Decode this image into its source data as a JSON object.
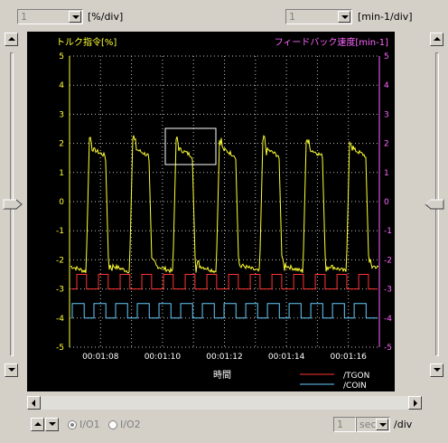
{
  "top": {
    "left_scale_value": "1",
    "left_scale_unit": "[%/div]",
    "right_scale_value": "1",
    "right_scale_unit": "[min-1/div]"
  },
  "chart_data": {
    "type": "line",
    "left_axis_label": "トルク指令[%]",
    "right_axis_label": "フィードバック速度[min-1]",
    "xlabel": "時間",
    "y_ticks": [
      "5",
      "4",
      "3",
      "2",
      "1",
      "0",
      "-1",
      "-2",
      "-3",
      "-4",
      "-5"
    ],
    "x_ticks": [
      "00:01:08",
      "00:01:10",
      "00:01:12",
      "00:01:14",
      "00:01:16"
    ],
    "ylim": [
      -5,
      5
    ],
    "grid": true,
    "colors": {
      "main": "#ffff33",
      "tgon": "#ff3333",
      "coin": "#66ccff",
      "right_axis": "#ff66ff",
      "grid": "#c0c0c0"
    },
    "series": [
      {
        "name": "/TGON",
        "color": "#ff3333",
        "low": -3.0,
        "high": -2.5
      },
      {
        "name": "/COIN",
        "color": "#66ccff",
        "low": -4.0,
        "high": -3.5
      }
    ],
    "main_signal": {
      "high": 1.8,
      "peak": 2.3,
      "low": -2.2,
      "trough": -2.5,
      "period_divs": 1.4
    }
  },
  "bottom": {
    "radio_1": "I/O1",
    "radio_2": "I/O2",
    "time_scale_value": "1",
    "time_unit": "sec",
    "time_suffix": "/div"
  }
}
